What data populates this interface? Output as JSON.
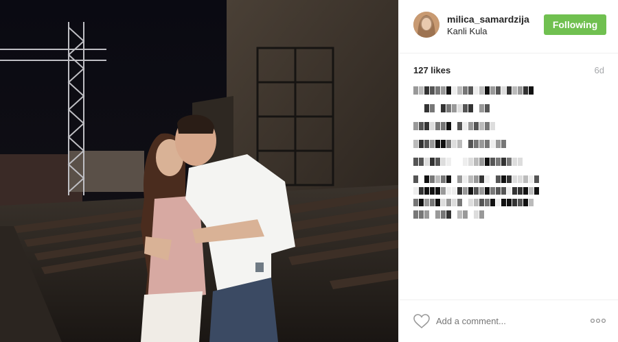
{
  "header": {
    "username": "milica_samardzija",
    "location": "Kanli Kula",
    "follow_label": "Following",
    "follow_color": "#70c050"
  },
  "meta": {
    "likes": "127 likes",
    "age": "6d"
  },
  "comments": {
    "pixelated": true
  },
  "footer": {
    "comment_placeholder": "Add a comment...",
    "like_icon": "heart-outline-icon",
    "more_icon": "more-options-icon"
  },
  "photo": {
    "description_icon": "post-photo"
  }
}
